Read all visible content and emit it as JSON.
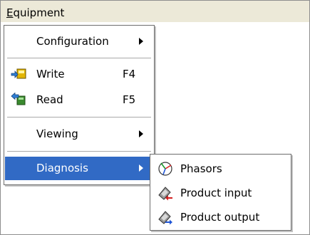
{
  "menubar": {
    "title_prefix": "E",
    "title_rest": "quipment"
  },
  "menu": {
    "items": [
      {
        "label": "Configuration",
        "shortcut": "",
        "has_submenu": true,
        "icon": ""
      },
      {
        "label": "Write",
        "shortcut": "F4",
        "has_submenu": false,
        "icon": "write-to-device-icon"
      },
      {
        "label": "Read",
        "shortcut": "F5",
        "has_submenu": false,
        "icon": "read-from-device-icon"
      },
      {
        "label": "Viewing",
        "shortcut": "",
        "has_submenu": true,
        "icon": ""
      },
      {
        "label": "Diagnosis",
        "shortcut": "",
        "has_submenu": true,
        "icon": "",
        "highlighted": true
      }
    ]
  },
  "submenu": {
    "items": [
      {
        "label": "Phasors",
        "icon": "phasors-icon"
      },
      {
        "label": "Product input",
        "icon": "product-input-icon"
      },
      {
        "label": "Product output",
        "icon": "product-output-icon"
      }
    ]
  },
  "colors": {
    "highlight": "#316ac5",
    "menubar_bg": "#ece9d8",
    "border": "#6d6d6d"
  }
}
